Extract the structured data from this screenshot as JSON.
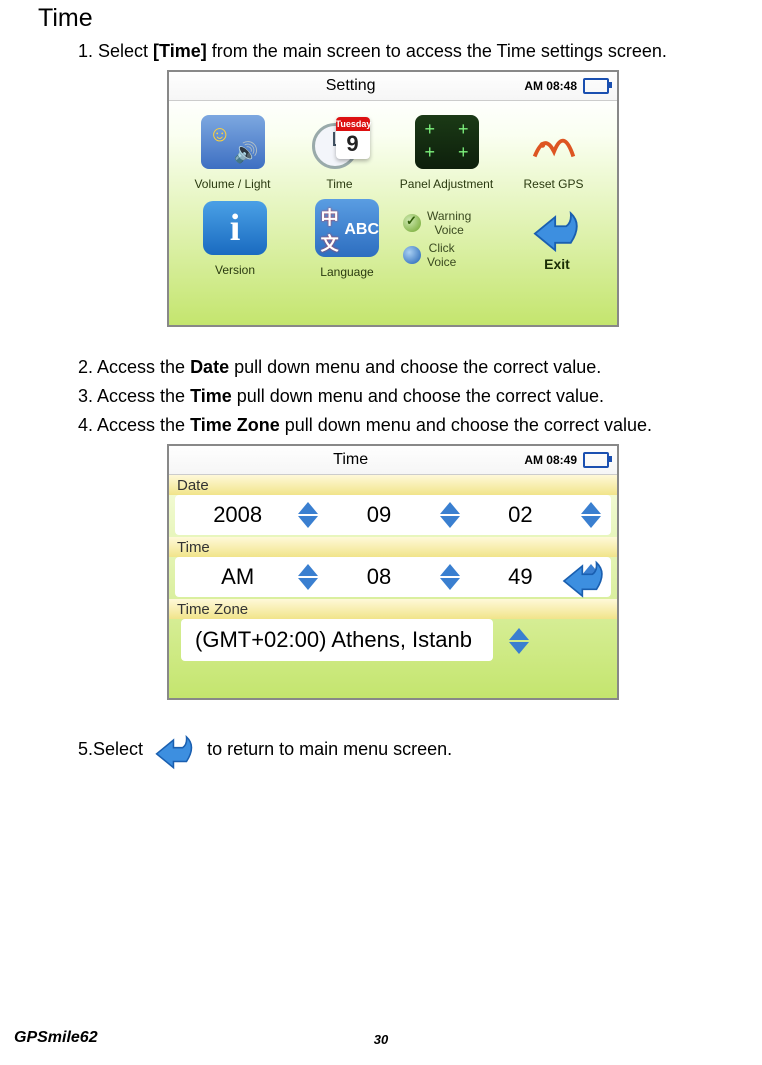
{
  "section_title": "Time",
  "steps": {
    "s1_a": "1. Select ",
    "s1_bold": "[Time]",
    "s1_b": " from the main screen to access the Time settings screen.",
    "s2_a": "2. Access the ",
    "s2_bold": "Date",
    "s2_b": " pull down menu and choose the correct value.",
    "s3_a": "3. Access the ",
    "s3_bold": "Time",
    "s3_b": " pull down menu and choose the correct value.",
    "s4_a": "4. Access the ",
    "s4_bold": "Time Zone",
    "s4_b": " pull down menu and choose the correct value.",
    "s5_a": "5.Select ",
    "s5_b": " to return to main menu screen."
  },
  "screen1": {
    "title": "Setting",
    "clock": "AM 08:48",
    "items": {
      "volume_light": "Volume / Light",
      "time": "Time",
      "panel": "Panel Adjustment",
      "reset_gps": "Reset GPS",
      "version": "Version",
      "language": "Language"
    },
    "calendar": {
      "day_name": "Tuesday",
      "day_num": "9"
    },
    "lang_text": {
      "cn": "中文",
      "abc": "ABC"
    },
    "voice": {
      "warning": "Warning\nVoice",
      "click": "Click\nVoice"
    },
    "exit": "Exit"
  },
  "screen2": {
    "title": "Time",
    "clock": "AM 08:49",
    "labels": {
      "date": "Date",
      "time": "Time",
      "tz": "Time Zone"
    },
    "date": {
      "year": "2008",
      "month": "09",
      "day": "02"
    },
    "time": {
      "ampm": "AM",
      "hour": "08",
      "minute": "49"
    },
    "tz": "(GMT+02:00) Athens, Istanb"
  },
  "footer": {
    "model": "GPSmile62",
    "page": "30"
  }
}
